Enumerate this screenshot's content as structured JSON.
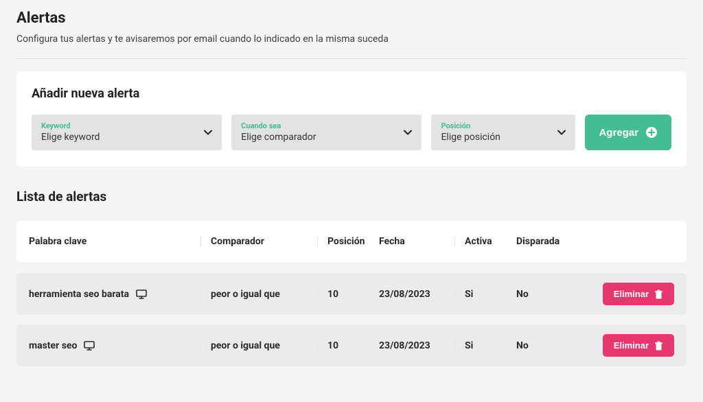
{
  "header": {
    "title": "Alertas",
    "subtitle": "Configura tus alertas y te avisaremos por email cuando lo indicado en la misma suceda"
  },
  "form": {
    "title": "Añadir nueva alerta",
    "keyword": {
      "label": "Keyword",
      "value": "Elige keyword"
    },
    "comparador": {
      "label": "Cuando sea",
      "value": "Elige comparador"
    },
    "posicion": {
      "label": "Posición",
      "value": "Elige posición"
    },
    "add_button": "Agregar"
  },
  "list": {
    "title": "Lista de alertas",
    "columns": {
      "keyword": "Palabra clave",
      "comparador": "Comparador",
      "posicion": "Posición",
      "fecha": "Fecha",
      "activa": "Activa",
      "disparada": "Disparada"
    },
    "rows": [
      {
        "keyword": "herramienta seo barata",
        "comparador": "peor o igual que",
        "posicion": "10",
        "fecha": "23/08/2023",
        "activa": "Si",
        "disparada": "No",
        "delete_label": "Eliminar"
      },
      {
        "keyword": "master seo",
        "comparador": "peor o igual que",
        "posicion": "10",
        "fecha": "23/08/2023",
        "activa": "Si",
        "disparada": "No",
        "delete_label": "Eliminar"
      }
    ]
  }
}
